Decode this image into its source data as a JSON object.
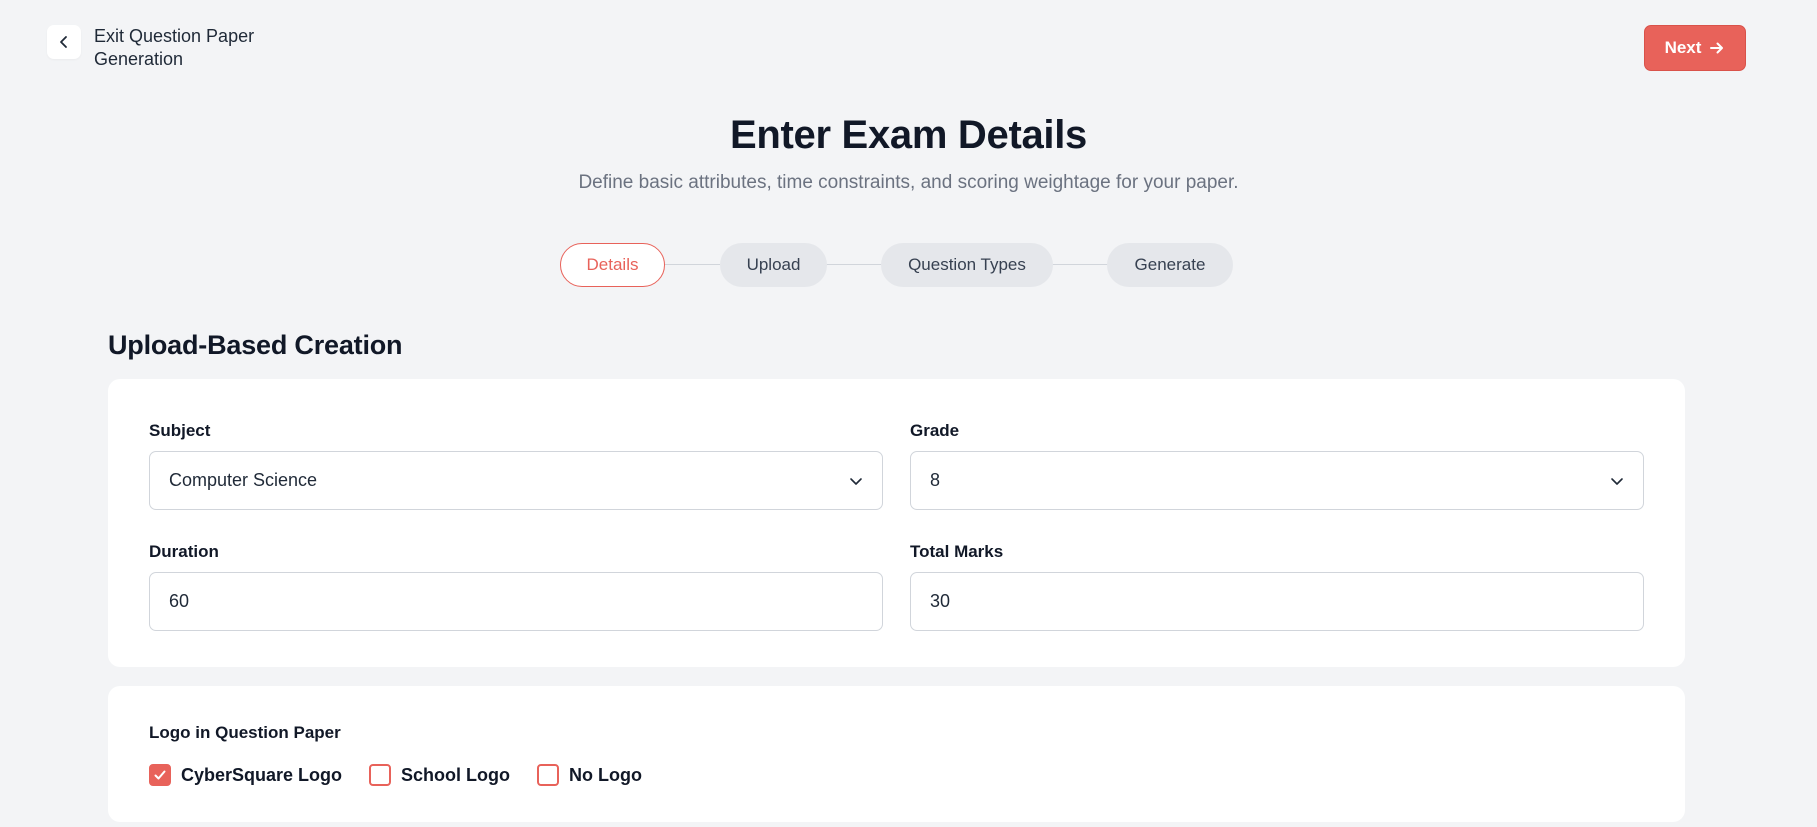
{
  "header": {
    "exit_label": "Exit Question Paper Generation",
    "next_label": "Next"
  },
  "page": {
    "title": "Enter Exam Details",
    "subtitle": "Define basic attributes, time constraints, and scoring weightage for your paper."
  },
  "stepper": {
    "steps": [
      {
        "label": "Details",
        "active": true
      },
      {
        "label": "Upload",
        "active": false
      },
      {
        "label": "Question Types",
        "active": false
      },
      {
        "label": "Generate",
        "active": false
      }
    ]
  },
  "section": {
    "title": "Upload-Based Creation"
  },
  "form": {
    "subject": {
      "label": "Subject",
      "value": "Computer Science"
    },
    "grade": {
      "label": "Grade",
      "value": "8"
    },
    "duration": {
      "label": "Duration",
      "value": "60"
    },
    "total_marks": {
      "label": "Total Marks",
      "value": "30"
    }
  },
  "logo": {
    "label": "Logo in Question Paper",
    "options": [
      {
        "label": "CyberSquare Logo",
        "checked": true
      },
      {
        "label": "School Logo",
        "checked": false
      },
      {
        "label": "No Logo",
        "checked": false
      }
    ]
  },
  "colors": {
    "accent": "#e8625a",
    "background": "#f3f4f6",
    "step_inactive": "#e5e7eb"
  },
  "icons": {
    "back": "chevron-left-icon",
    "next": "arrow-right-icon",
    "dropdown": "chevron-down-icon",
    "check": "check-icon"
  }
}
